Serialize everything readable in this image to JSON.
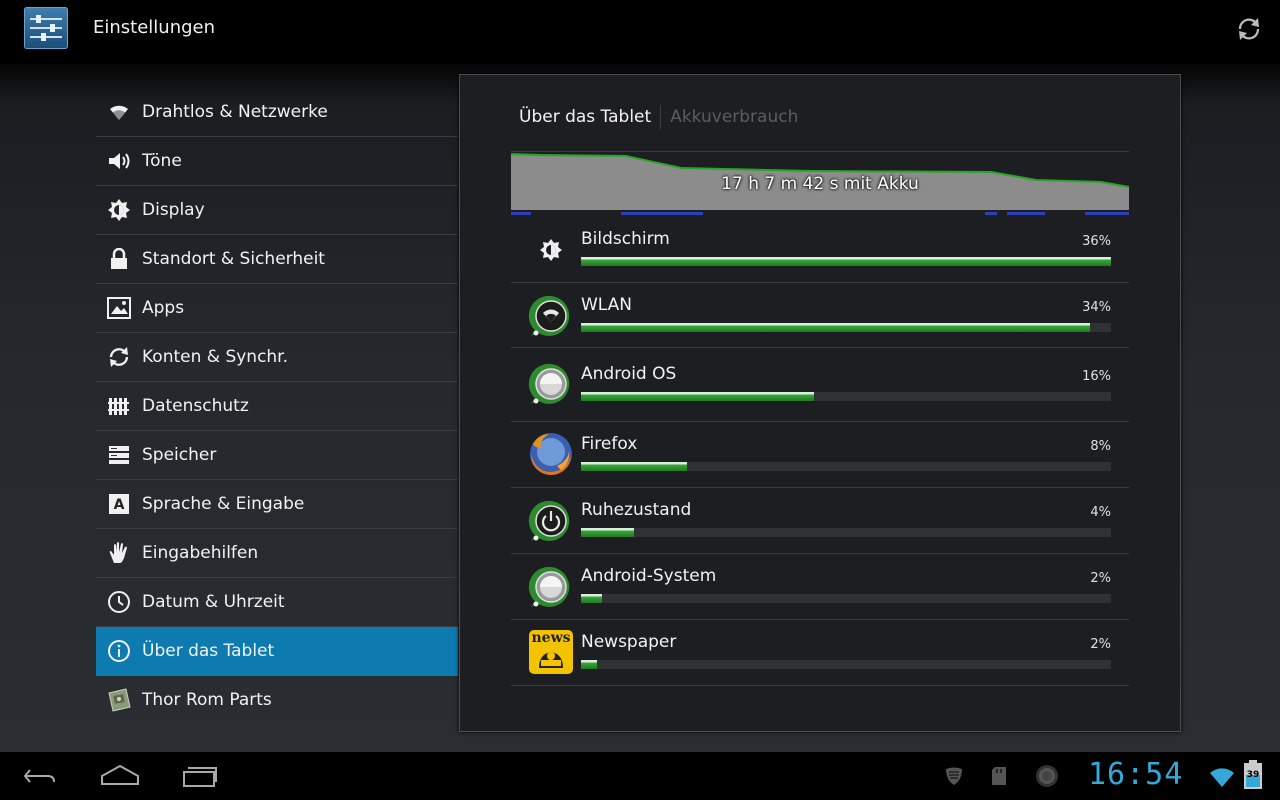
{
  "actionbar": {
    "title": "Einstellungen",
    "settings_icon": "settings-app-icon",
    "refresh_icon": "refresh-icon"
  },
  "sidebar": {
    "items": [
      {
        "label": "Drahtlos & Netzwerke",
        "icon": "wifi-icon"
      },
      {
        "label": "Töne",
        "icon": "speaker-icon"
      },
      {
        "label": "Display",
        "icon": "brightness-icon"
      },
      {
        "label": "Standort & Sicherheit",
        "icon": "lock-icon"
      },
      {
        "label": "Apps",
        "icon": "apps-icon"
      },
      {
        "label": "Konten & Synchr.",
        "icon": "sync-icon"
      },
      {
        "label": "Datenschutz",
        "icon": "privacy-icon"
      },
      {
        "label": "Speicher",
        "icon": "storage-icon"
      },
      {
        "label": "Sprache & Eingabe",
        "icon": "language-icon"
      },
      {
        "label": "Eingabehilfen",
        "icon": "hand-icon"
      },
      {
        "label": "Datum & Uhrzeit",
        "icon": "clock-icon"
      },
      {
        "label": "Über das Tablet",
        "icon": "info-icon",
        "selected": true
      },
      {
        "label": "Thor Rom Parts",
        "icon": "thor-icon"
      }
    ]
  },
  "panel": {
    "breadcrumb": {
      "current": "Über das Tablet",
      "next": "Akkuverbrauch"
    },
    "graph_label": "17 h 7 m 42 s mit Akku",
    "usage": [
      {
        "name": "Bildschirm",
        "percent": "36%",
        "fill": 1.0,
        "icon": "brightness-icon"
      },
      {
        "name": "WLAN",
        "percent": "34%",
        "fill": 0.96,
        "icon": "wifi-app-icon"
      },
      {
        "name": "Android OS",
        "percent": "16%",
        "fill": 0.44,
        "icon": "android-os-icon"
      },
      {
        "name": "Firefox",
        "percent": "8%",
        "fill": 0.2,
        "icon": "firefox-icon"
      },
      {
        "name": "Ruhezustand",
        "percent": "4%",
        "fill": 0.1,
        "icon": "power-icon"
      },
      {
        "name": "Android-System",
        "percent": "2%",
        "fill": 0.04,
        "icon": "android-system-icon"
      },
      {
        "name": "Newspaper",
        "percent": "2%",
        "fill": 0.03,
        "icon": "newspaper-icon",
        "icon_text": "news"
      }
    ]
  },
  "navbar": {
    "clock": "16:54",
    "battery_level": "39",
    "accent": "#36a8d8"
  }
}
